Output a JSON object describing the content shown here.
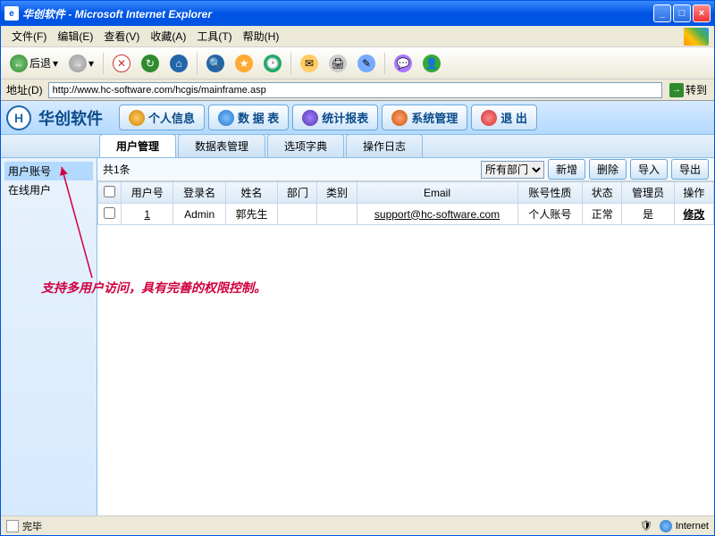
{
  "window": {
    "title": "华创软件 - Microsoft Internet Explorer"
  },
  "menus": [
    "文件(F)",
    "编辑(E)",
    "查看(V)",
    "收藏(A)",
    "工具(T)",
    "帮助(H)"
  ],
  "toolbar": {
    "back": "后退"
  },
  "address": {
    "label": "地址(D)",
    "url": "http://www.hc-software.com/hcgis/mainframe.asp",
    "go": "转到"
  },
  "app": {
    "brand": "华创软件",
    "nav": {
      "personal": "个人信息",
      "data": "数 据 表",
      "stats": "统计报表",
      "system": "系统管理",
      "exit": "退  出"
    }
  },
  "tabs": {
    "user_mgmt": "用户管理",
    "table_mgmt": "数据表管理",
    "dict": "选项字典",
    "oplog": "操作日志"
  },
  "side": {
    "accounts": "用户账号",
    "online": "在线用户"
  },
  "tablebar": {
    "count": "共1条",
    "dept_filter": "所有部门",
    "add": "新增",
    "del": "删除",
    "import": "导入",
    "export": "导出"
  },
  "columns": {
    "userid": "用户号",
    "login": "登录名",
    "name": "姓名",
    "dept": "部门",
    "type": "类别",
    "email": "Email",
    "acct_type": "账号性质",
    "status": "状态",
    "admin": "管理员",
    "ops": "操作"
  },
  "rows": [
    {
      "userid": "1",
      "login": "Admin",
      "name": "郭先生",
      "dept": "",
      "type": "",
      "email": "support@hc-software.com",
      "acct_type": "个人账号",
      "status": "正常",
      "admin": "是",
      "ops": "修改"
    }
  ],
  "annotation": "支持多用户访问，具有完善的权限控制。",
  "status": {
    "done": "完毕",
    "zone": "Internet"
  }
}
